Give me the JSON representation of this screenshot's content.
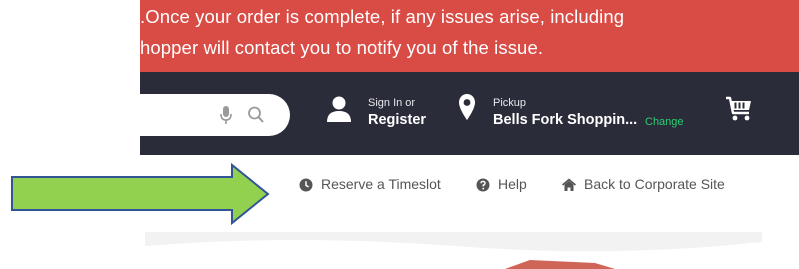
{
  "banner": {
    "line1": ".Once your order is complete, if any issues arise, including",
    "line2": "hopper will contact you to notify you of the issue.",
    "bg_color": "#d94b45"
  },
  "header": {
    "bg_color": "#2b2c3a",
    "search": {
      "mic_icon": "microphone-icon",
      "search_icon": "magnifier-icon"
    },
    "account": {
      "small": "Sign In or",
      "big": "Register",
      "icon": "user-icon"
    },
    "pickup": {
      "small": "Pickup",
      "store": "Bells Fork Shoppin...",
      "change": "Change",
      "change_color": "#2ecc71",
      "icon": "map-pin-icon"
    },
    "cart": {
      "icon": "shopping-cart-icon"
    }
  },
  "annotation": {
    "arrow_color": "#92d050",
    "arrow_border": "#2f5597"
  },
  "nav_links": [
    {
      "label": "Reserve a Timeslot",
      "icon": "clock-icon"
    },
    {
      "label": "Help",
      "icon": "question-circle-icon"
    },
    {
      "label": "Back to Corporate Site",
      "icon": "home-icon"
    }
  ]
}
